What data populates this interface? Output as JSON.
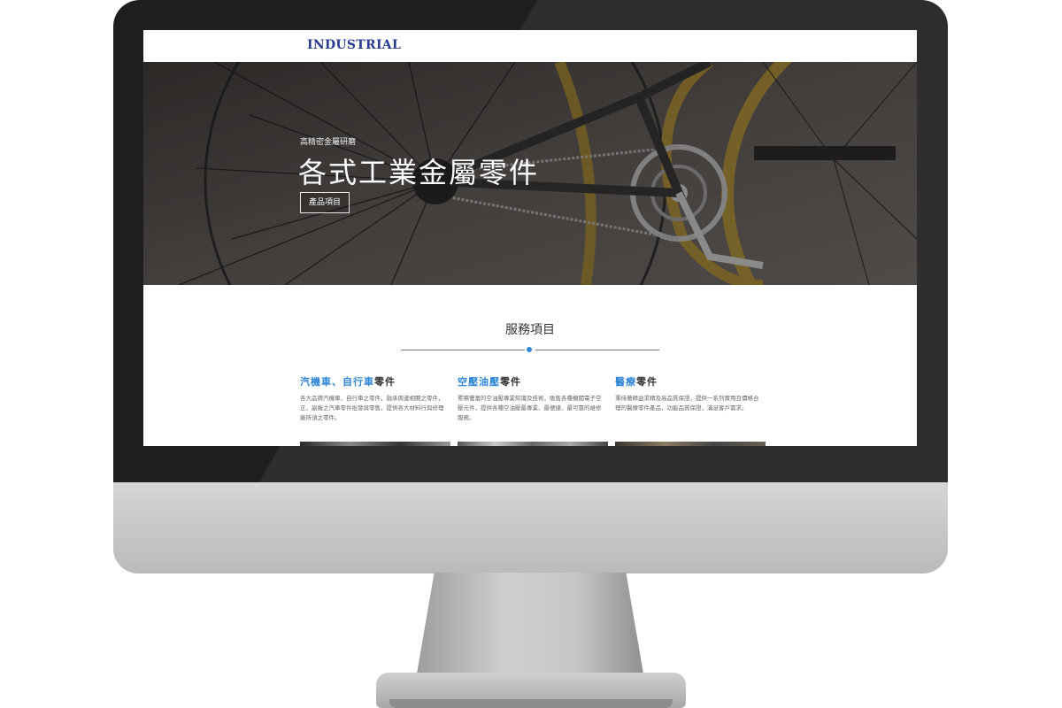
{
  "site": {
    "logo_text": "INDUSTRIAL"
  },
  "hero": {
    "subtitle": "高精密金屬研磨",
    "title": "各式工業金屬零件",
    "button_label": "產品項目"
  },
  "services": {
    "heading": "服務項目",
    "items": [
      {
        "title_highlight": "汽機車、自行車",
        "title_rest": "零件",
        "description": "各大品牌汽機車、自行車之零件，融承周邊相關之零件，正、副廠之汽車零件批發與零售，提供各大材料行與修理廠所須之零件。"
      },
      {
        "title_highlight": "空壓油壓",
        "title_rest": "零件",
        "description": "累積豐富的空油壓專業知識及技術，販售各種機閥電子空壓元件，提供各種空油壓最專業、最便捷、最可靠的維修服務。"
      },
      {
        "title_highlight": "醫療",
        "title_rest": "零件",
        "description": "秉持著精益求精及高品質保證，提供一系列實用且價格合理的醫療零件產品，功能品質保證，滿足客戶需求。"
      }
    ]
  },
  "colors": {
    "accent": "#2f86d6",
    "logo": "#2a3c8f",
    "bezel": "#1e1e1f"
  }
}
